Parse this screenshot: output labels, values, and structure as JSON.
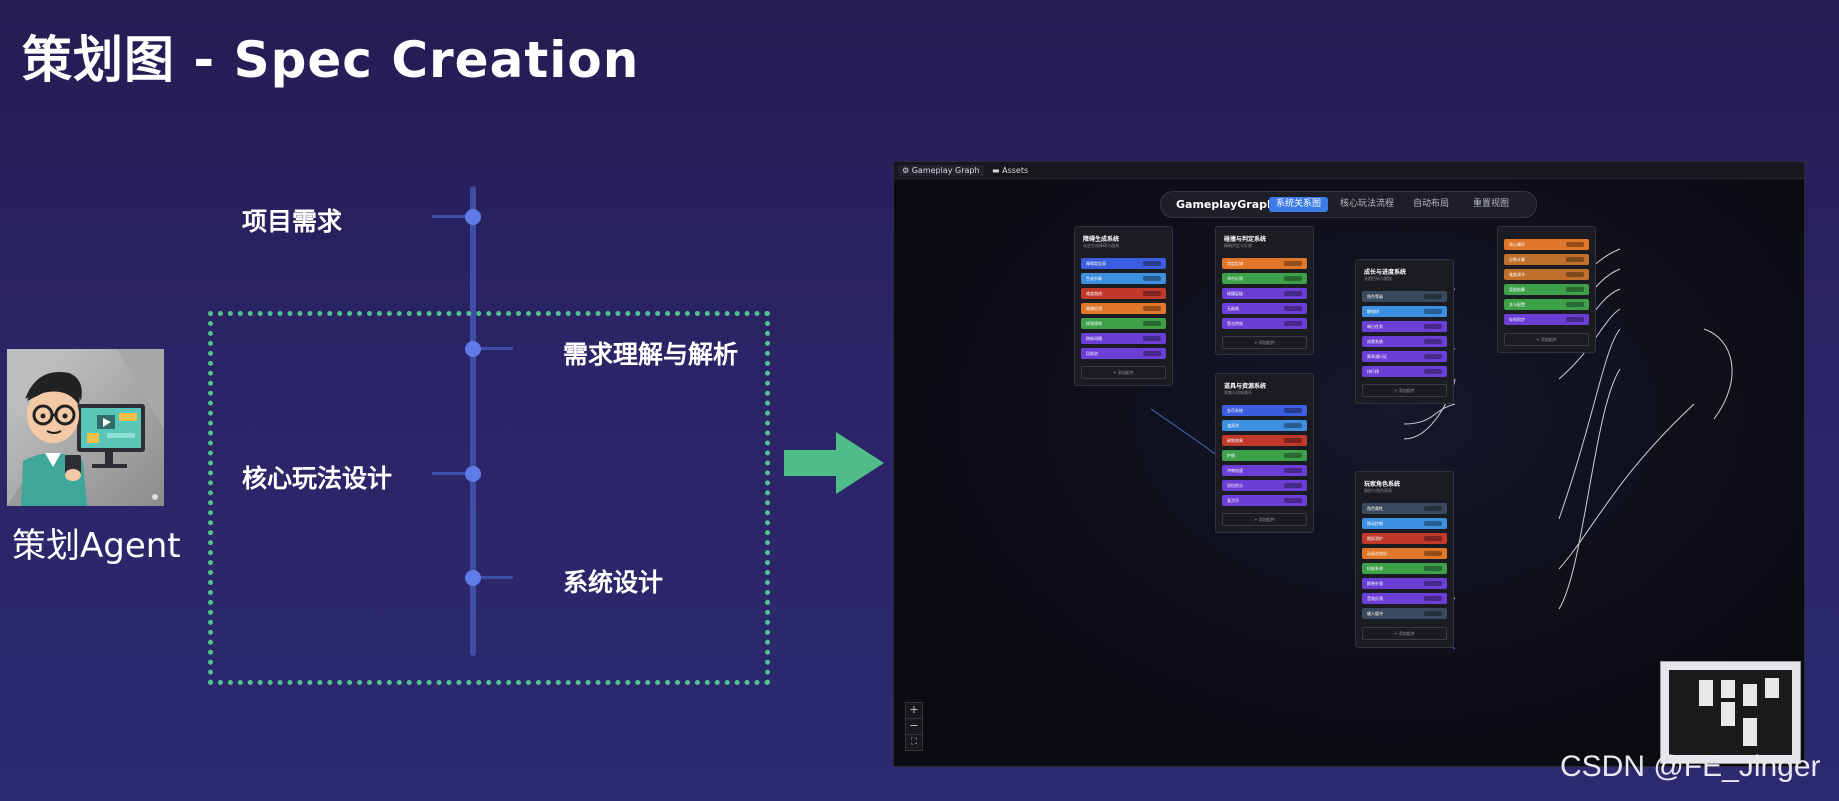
{
  "slide": {
    "title": "策划图 - Spec Creation",
    "agent_label": "策划Agent",
    "watermark": "CSDN @FE_Jinger"
  },
  "timeline": {
    "items": [
      {
        "label": "项目需求"
      },
      {
        "label": "需求理解与解析"
      },
      {
        "label": "核心玩法设计"
      },
      {
        "label": "系统设计"
      }
    ]
  },
  "colors": {
    "accent_green": "#4fc48d",
    "timeline_blue": "#3d4da8",
    "dot_blue": "#5f7be8",
    "toolbar_active": "#3c7be8"
  },
  "app": {
    "tabs": [
      {
        "label": "Gameplay Graph",
        "icon": "graph-icon"
      },
      {
        "label": "Assets",
        "icon": "folder-icon"
      }
    ],
    "toolbar": {
      "brand": "GameplayGraph",
      "buttons": [
        "系统关系图",
        "核心玩法流程",
        "自动布局",
        "重置视图"
      ]
    },
    "nodes": [
      {
        "title": "障碍生成系统",
        "sub": "动态生成障碍与道具",
        "rows": [
          "障碍类型表",
          "生成节奏",
          "难度曲线",
          "碰撞检测",
          "掉落规则",
          "刷新间隔",
          "回收池"
        ],
        "colors": [
          "#3b5ee0",
          "#3d8fe0",
          "#c0392b",
          "#e0772a",
          "#3ea14a",
          "#6b3fd6",
          "#6b3fd6"
        ],
        "add": "+ 添加组件"
      },
      {
        "title": "碰撞与判定系统",
        "sub": "精确判定与反馈",
        "rows": [
          "判定区域",
          "命中反馈",
          "碰撞层级",
          "无敌帧",
          "受击特效"
        ],
        "colors": [
          "#e0772a",
          "#3ea14a",
          "#6b3fd6",
          "#6b3fd6",
          "#6b3fd6"
        ],
        "add": "+ 添加组件"
      },
      {
        "title": "道具与资源系统",
        "sub": "收集与消耗循环",
        "rows": [
          "金币系统",
          "道具池",
          "磁铁效果",
          "护盾",
          "冲刺加速",
          "双倍积分",
          "复活币"
        ],
        "colors": [
          "#3b5ee0",
          "#3d8fe0",
          "#c0392b",
          "#3ea14a",
          "#6b3fd6",
          "#6b3fd6",
          "#6b3fd6"
        ],
        "add": "+ 添加组件"
      },
      {
        "title": "成长与进度系统",
        "sub": "长期目标与解锁",
        "rows": [
          "角色等级",
          "解锁树",
          "每日任务",
          "成就系统",
          "赛季通行证",
          "排行榜"
        ],
        "colors": [
          "#3a4a5e",
          "#3d8fe0",
          "#6b3fd6",
          "#6b3fd6",
          "#6b3fd6",
          "#6b3fd6"
        ],
        "add": "+ 添加组件"
      },
      {
        "title": "",
        "sub": "",
        "rows": [
          "核心循环",
          "分数计算",
          "难度调节",
          "奖励结算",
          "关卡配置",
          "存档同步"
        ],
        "colors": [
          "#e0772a",
          "#c0702a",
          "#c0702a",
          "#3ea14a",
          "#3ea14a",
          "#6b3fd6"
        ],
        "add": "+ 添加组件"
      },
      {
        "title": "玩家角色系统",
        "sub": "操控与角色表现",
        "rows": [
          "角色属性",
          "移动控制",
          "跳跃滑铲",
          "动画状态机",
          "技能系统",
          "换装外观",
          "音效反馈",
          "输入缓冲"
        ],
        "colors": [
          "#3a4a5e",
          "#3d8fe0",
          "#c0392b",
          "#e0772a",
          "#3ea14a",
          "#6b3fd6",
          "#6b3fd6",
          "#3a4a5e"
        ],
        "add": "+ 添加组件"
      }
    ],
    "zoom": [
      "+",
      "−",
      "⛶"
    ]
  }
}
